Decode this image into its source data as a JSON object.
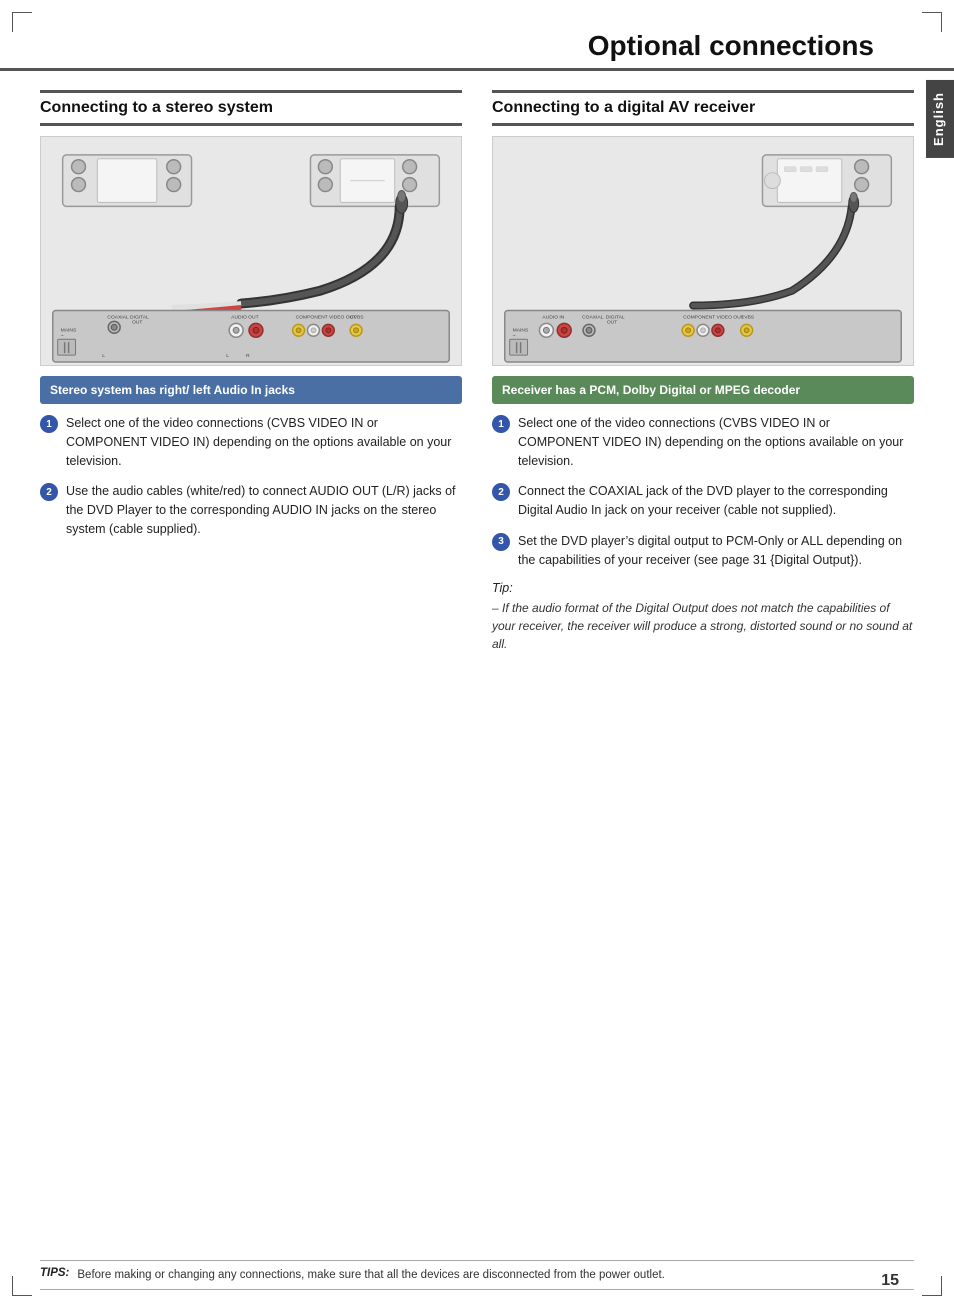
{
  "page": {
    "title": "Optional connections",
    "page_number": "15",
    "english_label": "English"
  },
  "tips_bar": {
    "label": "TIPS:",
    "text": "Before making or changing any connections, make sure that all the devices are disconnected from the power outlet."
  },
  "left_section": {
    "heading": "Connecting to a stereo system",
    "highlight_box_text": "Stereo system has right/ left Audio In jacks",
    "steps": [
      {
        "num": "1",
        "text": "Select one of the video connections (CVBS VIDEO IN or COMPONENT VIDEO IN) depending on the options available on your television."
      },
      {
        "num": "2",
        "text": "Use the audio cables (white/red) to connect AUDIO OUT (L/R) jacks of the DVD Player to the corresponding AUDIO IN jacks on the stereo system (cable supplied)."
      }
    ]
  },
  "right_section": {
    "heading": "Connecting to a digital AV receiver",
    "highlight_box_text": "Receiver has a PCM, Dolby Digital or MPEG decoder",
    "steps": [
      {
        "num": "1",
        "text": "Select one of the video connections (CVBS VIDEO IN or COMPONENT VIDEO IN) depending on the options available on your television."
      },
      {
        "num": "2",
        "text": "Connect the COAXIAL jack of the DVD player to the corresponding Digital Audio In jack on your receiver (cable not supplied)."
      },
      {
        "num": "3",
        "text": "Set the DVD player’s digital output to PCM-Only or ALL depending on the capabilities of your receiver (see page 31 {Digital Output})."
      }
    ],
    "tip_title": "Tip:",
    "tip_text": "–  If the audio format of the Digital Output does not match the capabilities of your receiver, the receiver will produce a strong, distorted sound or no sound at all."
  }
}
